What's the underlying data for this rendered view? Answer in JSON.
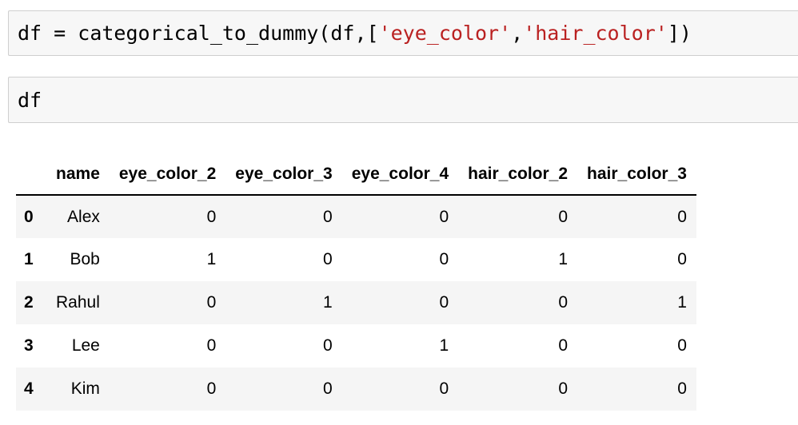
{
  "cells": {
    "cell1": {
      "tokens": [
        "df",
        " = ",
        "categorical_to_dummy",
        "(df,[",
        "'eye_color'",
        ",",
        "'hair_color'",
        "])"
      ]
    },
    "cell2": {
      "code": "df"
    }
  },
  "dataframe": {
    "columns": [
      "name",
      "eye_color_2",
      "eye_color_3",
      "eye_color_4",
      "hair_color_2",
      "hair_color_3"
    ],
    "rows": [
      {
        "index": "0",
        "values": [
          "Alex",
          "0",
          "0",
          "0",
          "0",
          "0"
        ]
      },
      {
        "index": "1",
        "values": [
          "Bob",
          "1",
          "0",
          "0",
          "1",
          "0"
        ]
      },
      {
        "index": "2",
        "values": [
          "Rahul",
          "0",
          "1",
          "0",
          "0",
          "1"
        ]
      },
      {
        "index": "3",
        "values": [
          "Lee",
          "0",
          "0",
          "1",
          "0",
          "0"
        ]
      },
      {
        "index": "4",
        "values": [
          "Kim",
          "0",
          "0",
          "0",
          "0",
          "0"
        ]
      }
    ]
  },
  "colors": {
    "string_literal": "#ba2121",
    "cell_background": "#f7f7f7",
    "cell_border": "#cfcfcf",
    "row_stripe": "#f5f5f5"
  }
}
